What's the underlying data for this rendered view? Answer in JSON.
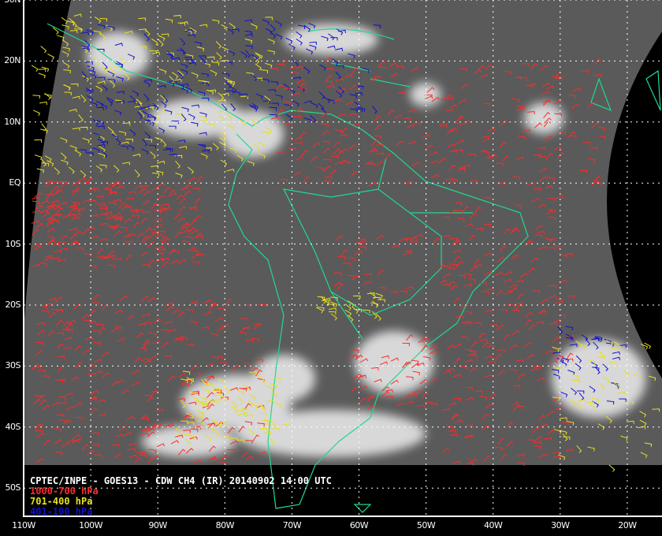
{
  "title": "CPTEC/INPE - GOES13 - CDW CH4 (IR) 20140902 14:00 UTC",
  "legend": [
    {
      "label": "1000-700 hPa",
      "color": "#ff2a2a"
    },
    {
      "label": "701-400 hPa",
      "color": "#e8e020"
    },
    {
      "label": "401-100 hPa",
      "color": "#1010d0"
    }
  ],
  "axes": {
    "latitude_labels": [
      "30N",
      "20N",
      "10N",
      "EQ",
      "10S",
      "20S",
      "30S",
      "40S",
      "50S"
    ],
    "longitude_labels": [
      "110W",
      "100W",
      "90W",
      "80W",
      "70W",
      "60W",
      "50W",
      "40W",
      "30W",
      "20W"
    ]
  },
  "colors": {
    "coastline": "#20d890",
    "grid": "#ffffff",
    "background": "#000000"
  }
}
